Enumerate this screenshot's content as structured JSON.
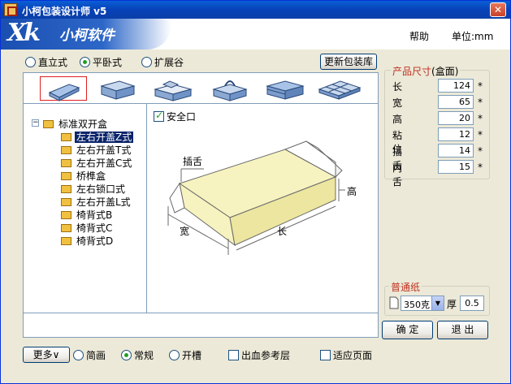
{
  "window": {
    "title": "小柯包装设计师 v5",
    "close_glyph": "✕"
  },
  "header": {
    "logo_mark": "Xk",
    "logo_text": "小柯软件",
    "help": "帮助",
    "unit": "单位:mm"
  },
  "modes": [
    {
      "label": "直立式",
      "selected": false
    },
    {
      "label": "平卧式",
      "selected": true
    },
    {
      "label": "扩展谷",
      "selected": false
    }
  ],
  "update_library_label": "更新包装库",
  "shape_icons": [
    "flat-box-icon",
    "tray-box-icon",
    "gable-box-icon",
    "handle-box-icon",
    "lid-box-icon",
    "grid-box-icon"
  ],
  "tree": {
    "root": "标准双开盒",
    "items": [
      {
        "label": "左右开盖Z式",
        "selected": true
      },
      {
        "label": "左右开盖T式",
        "selected": false
      },
      {
        "label": "左右开盖C式",
        "selected": false
      },
      {
        "label": "桥榫盒",
        "selected": false
      },
      {
        "label": "左右锁口式",
        "selected": false
      },
      {
        "label": "左右开盖L式",
        "selected": false
      },
      {
        "label": "椅背式B",
        "selected": false
      },
      {
        "label": "椅背式C",
        "selected": false
      },
      {
        "label": "椅背式D",
        "selected": false
      }
    ]
  },
  "preview": {
    "safety_label": "安全口",
    "safety_checked": true,
    "labels": {
      "tuck": "插舌",
      "height": "高",
      "width": "宽",
      "length": "长"
    }
  },
  "dimensions": {
    "title": "产品尺寸",
    "subtitle": "(盒面)",
    "rows": [
      {
        "label": "长",
        "value": "124"
      },
      {
        "label": "宽",
        "value": "65"
      },
      {
        "label": "高",
        "value": "20"
      },
      {
        "label": "粘位",
        "value": "12"
      },
      {
        "label": "插舌",
        "value": "14"
      },
      {
        "label": "内舌",
        "value": "15"
      }
    ],
    "required_mark": "*"
  },
  "paper": {
    "title": "普通纸",
    "weight": "350克",
    "thickness_label": "厚",
    "thickness": "0.5"
  },
  "actions": {
    "ok": "确 定",
    "exit": "退 出"
  },
  "bottom": {
    "more_label": "更多∨",
    "views": [
      {
        "label": "简画",
        "selected": false
      },
      {
        "label": "常规",
        "selected": true
      },
      {
        "label": "开槽",
        "selected": false
      }
    ],
    "bleed_label": "出血参考层",
    "fit_label": "适应页面"
  },
  "colors": {
    "titlebar": "#0a5fd6",
    "accent_red": "#c03020",
    "selection": "#0a246a",
    "box_fill": "#f7f3c0"
  }
}
